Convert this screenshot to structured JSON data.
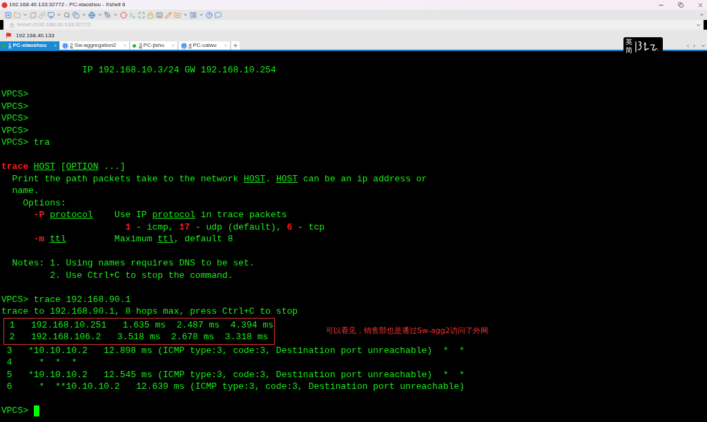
{
  "window": {
    "title": "192.168.40.133:32772 - PC-xiaoshou - Xshell 6"
  },
  "address_bar": {
    "value": "telnet://192.168.40.133:32772"
  },
  "session_bar": {
    "host": "192.168.40.133"
  },
  "tabs": [
    {
      "number": "1",
      "label": "PC-xiaoshou",
      "kind": "connected",
      "selected": true
    },
    {
      "number": "2",
      "label": "Sw-aggregation2",
      "kind": "info",
      "selected": false
    },
    {
      "number": "3",
      "label": "PC-jishu",
      "kind": "connected",
      "selected": false
    },
    {
      "number": "4",
      "label": "PC-caiwu",
      "kind": "info",
      "selected": false
    }
  ],
  "ime": {
    "language": "英",
    "script": "简"
  },
  "terminal": {
    "lines": [
      {
        "kind": "text",
        "segments": [
          {
            "text": "               IP 192.168.10.3/24 GW 192.168.10.254",
            "kind": "plain"
          }
        ]
      },
      {
        "kind": "blank"
      },
      {
        "kind": "text",
        "segments": [
          {
            "text": "VPCS>",
            "kind": "plain"
          }
        ]
      },
      {
        "kind": "text",
        "segments": [
          {
            "text": "VPCS>",
            "kind": "plain"
          }
        ]
      },
      {
        "kind": "text",
        "segments": [
          {
            "text": "VPCS>",
            "kind": "plain"
          }
        ]
      },
      {
        "kind": "text",
        "segments": [
          {
            "text": "VPCS>",
            "kind": "plain"
          }
        ]
      },
      {
        "kind": "text",
        "segments": [
          {
            "text": "VPCS> tra",
            "kind": "plain"
          }
        ]
      },
      {
        "kind": "blank"
      },
      {
        "kind": "text",
        "segments": [
          {
            "text": "trace ",
            "kind": "red"
          },
          {
            "text": "HOST",
            "kind": "underline"
          },
          {
            "text": " [",
            "kind": "plain"
          },
          {
            "text": "OPTION",
            "kind": "underline"
          },
          {
            "text": " ...]",
            "kind": "plain"
          }
        ]
      },
      {
        "kind": "text",
        "segments": [
          {
            "text": "  Print the path packets take to the network ",
            "kind": "plain"
          },
          {
            "text": "HOST",
            "kind": "underline"
          },
          {
            "text": ". ",
            "kind": "plain"
          },
          {
            "text": "HOST",
            "kind": "underline"
          },
          {
            "text": " can be an ip address or",
            "kind": "plain"
          }
        ]
      },
      {
        "kind": "text",
        "segments": [
          {
            "text": "  name.",
            "kind": "plain"
          }
        ]
      },
      {
        "kind": "text",
        "segments": [
          {
            "text": "    Options:",
            "kind": "plain"
          }
        ]
      },
      {
        "kind": "text",
        "segments": [
          {
            "text": "      -P ",
            "kind": "red"
          },
          {
            "text": "protocol",
            "kind": "underline"
          },
          {
            "text": "    Use IP ",
            "kind": "plain"
          },
          {
            "text": "protocol",
            "kind": "underline"
          },
          {
            "text": " in trace packets",
            "kind": "plain"
          }
        ]
      },
      {
        "kind": "text",
        "segments": [
          {
            "text": "                       1",
            "kind": "red"
          },
          {
            "text": " - icmp, ",
            "kind": "plain"
          },
          {
            "text": "17",
            "kind": "red"
          },
          {
            "text": " - udp (default), ",
            "kind": "plain"
          },
          {
            "text": "6",
            "kind": "red"
          },
          {
            "text": " - tcp",
            "kind": "plain"
          }
        ]
      },
      {
        "kind": "text",
        "segments": [
          {
            "text": "      -m ",
            "kind": "red"
          },
          {
            "text": "ttl",
            "kind": "underline"
          },
          {
            "text": "         Maximum ",
            "kind": "plain"
          },
          {
            "text": "ttl",
            "kind": "underline"
          },
          {
            "text": ", default 8",
            "kind": "plain"
          }
        ]
      },
      {
        "kind": "blank"
      },
      {
        "kind": "text",
        "segments": [
          {
            "text": "  Notes: 1. Using names requires DNS to be set.",
            "kind": "plain"
          }
        ]
      },
      {
        "kind": "text",
        "segments": [
          {
            "text": "         2. Use Ctrl+C to stop the command.",
            "kind": "plain"
          }
        ]
      },
      {
        "kind": "blank"
      },
      {
        "kind": "text",
        "segments": [
          {
            "text": "VPCS> trace 192.168.90.1",
            "kind": "plain"
          }
        ]
      },
      {
        "kind": "text",
        "segments": [
          {
            "text": "trace to 192.168.90.1, 8 hops max, press Ctrl+C to stop",
            "kind": "plain"
          }
        ]
      },
      {
        "kind": "boxed",
        "note": "可以看见，销售部也是通过Sw-agg2访问了外网",
        "rows": [
          {
            "segments": [
              {
                "text": " 1   192.168.10.251   1.635 ms  2.487 ms  4.394 ms",
                "kind": "plain"
              }
            ]
          },
          {
            "segments": [
              {
                "text": " 2   192.168.106.2   3.518 ms  2.678 ms  3.318 ms",
                "kind": "plain"
              }
            ]
          }
        ]
      },
      {
        "kind": "text",
        "segments": [
          {
            "text": " 3   *10.10.10.2   12.898 ms (ICMP type:3, code:3, Destination port unreachable)  *  *",
            "kind": "plain"
          }
        ]
      },
      {
        "kind": "text",
        "segments": [
          {
            "text": " 4     *  *  *",
            "kind": "plain"
          }
        ]
      },
      {
        "kind": "text",
        "segments": [
          {
            "text": " 5   *10.10.10.2   12.545 ms (ICMP type:3, code:3, Destination port unreachable)  *  *",
            "kind": "plain"
          }
        ]
      },
      {
        "kind": "text",
        "segments": [
          {
            "text": " 6     *  **10.10.10.2   12.639 ms (ICMP type:3, code:3, Destination port unreachable)",
            "kind": "plain"
          }
        ]
      },
      {
        "kind": "blank"
      },
      {
        "kind": "text",
        "cursor": true,
        "segments": [
          {
            "text": "VPCS> ",
            "kind": "plain"
          }
        ]
      }
    ]
  }
}
